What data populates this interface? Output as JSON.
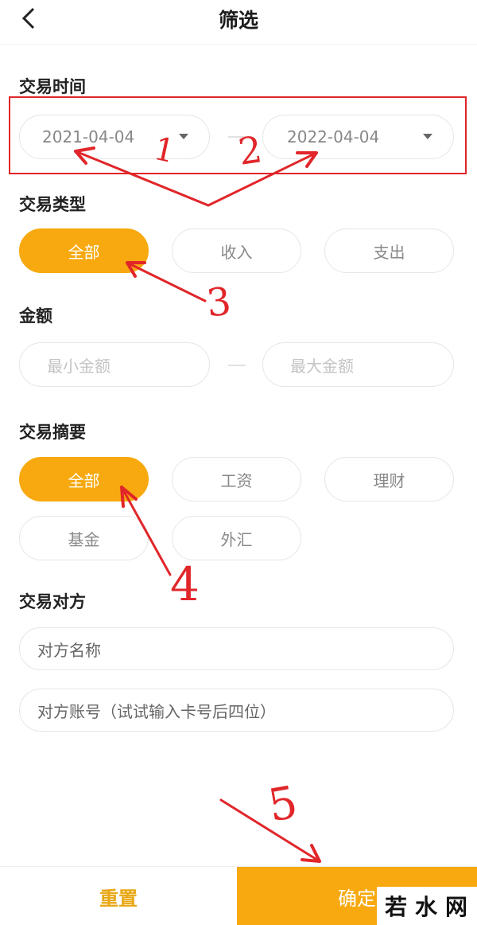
{
  "header": {
    "title": "筛选",
    "back_icon": "chevron-left-icon"
  },
  "trade_time": {
    "label": "交易时间",
    "start_date": "2021-04-04",
    "end_date": "2022-04-04"
  },
  "trade_type": {
    "label": "交易类型",
    "options": [
      "全部",
      "收入",
      "支出"
    ],
    "selected": "全部"
  },
  "amount": {
    "label": "金额",
    "min_placeholder": "最小金额",
    "max_placeholder": "最大金额"
  },
  "summary": {
    "label": "交易摘要",
    "options": [
      "全部",
      "工资",
      "理财",
      "基金",
      "外汇"
    ],
    "selected": "全部"
  },
  "counterparty": {
    "label": "交易对方",
    "name_placeholder": "对方名称",
    "account_placeholder": "对方账号（试试输入卡号后四位）"
  },
  "footer": {
    "reset_label": "重置",
    "confirm_label": "确定"
  },
  "annotations": {
    "numbers": [
      "1",
      "2",
      "3",
      "4",
      "5"
    ]
  },
  "watermark": {
    "text": "若水网"
  },
  "colors": {
    "accent": "#f7a90f",
    "annotation_red": "#e1262a"
  }
}
